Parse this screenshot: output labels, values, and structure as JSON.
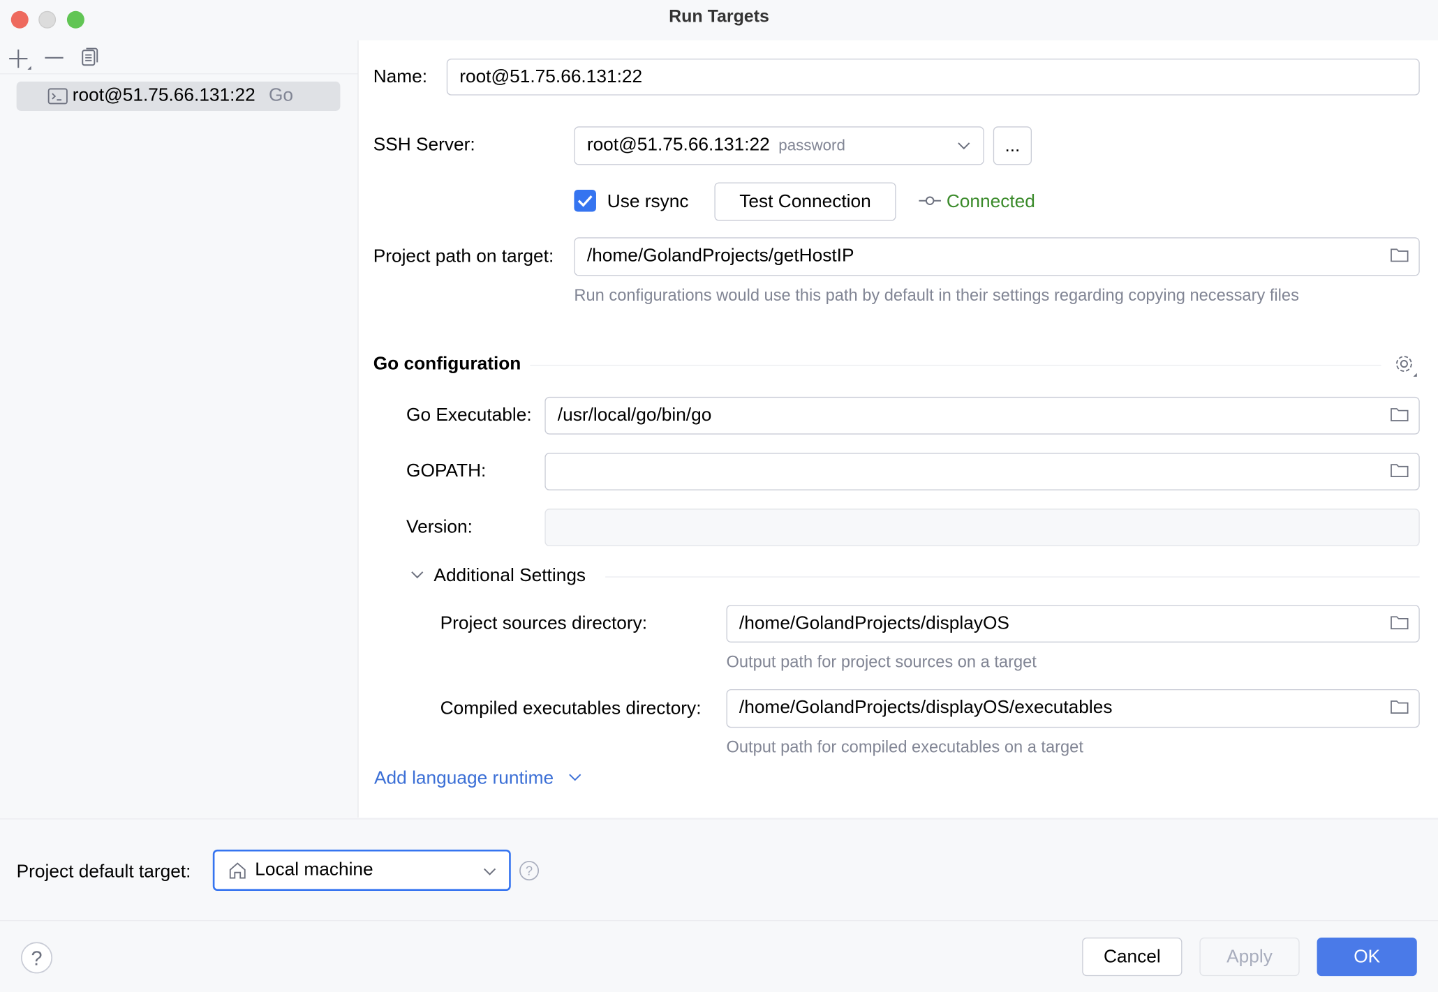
{
  "window": {
    "title": "Run Targets"
  },
  "sidebar": {
    "items": [
      {
        "label": "root@51.75.66.131:22",
        "type": "Go"
      }
    ]
  },
  "form": {
    "name_label": "Name:",
    "name_value": "root@51.75.66.131:22",
    "ssh_label": "SSH Server:",
    "ssh_value": "root@51.75.66.131:22",
    "ssh_auth": "password",
    "ssh_more": "...",
    "rsync_label": "Use rsync",
    "rsync_checked": true,
    "test_connection": "Test Connection",
    "status": "Connected",
    "project_path_label": "Project path on target:",
    "project_path_value": "/home/GolandProjects/getHostIP",
    "project_path_hint": "Run configurations would use this path by default in their settings regarding copying necessary files",
    "go_section": "Go configuration",
    "go_exec_label": "Go Executable:",
    "go_exec_value": "/usr/local/go/bin/go",
    "gopath_label": "GOPATH:",
    "gopath_value": "",
    "version_label": "Version:",
    "version_value": "",
    "additional_label": "Additional Settings",
    "sources_label": "Project sources directory:",
    "sources_value": "/home/GolandProjects/displayOS",
    "sources_hint": "Output path for project sources on a target",
    "compiled_label": "Compiled executables directory:",
    "compiled_value": "/home/GolandProjects/displayOS/executables",
    "compiled_hint": "Output path for compiled executables on a target",
    "add_runtime": "Add language runtime"
  },
  "footer": {
    "default_target_label": "Project default target:",
    "default_target_value": "Local machine",
    "cancel": "Cancel",
    "apply": "Apply",
    "ok": "OK"
  },
  "colors": {
    "accent": "#4a7ae8",
    "connected": "#3a8a2a"
  }
}
